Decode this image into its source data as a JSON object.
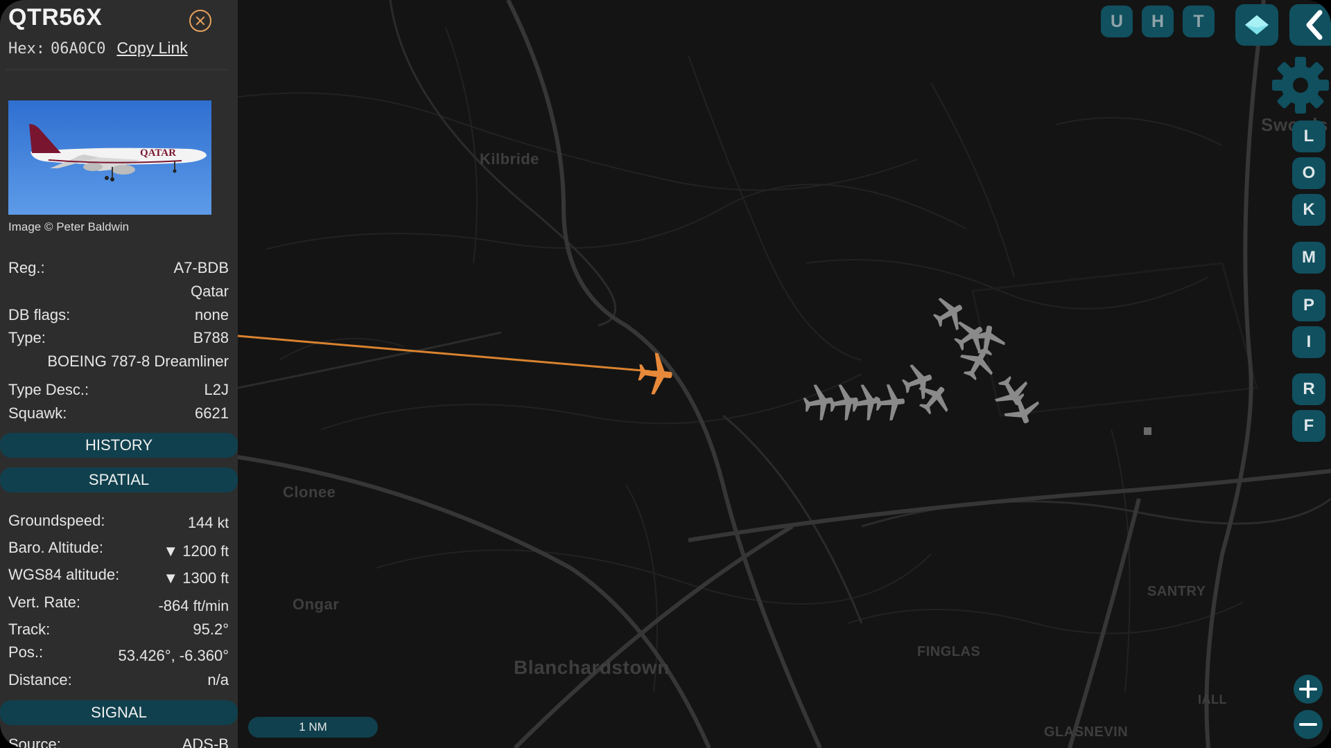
{
  "aircraft": {
    "callsign": "QTR56X",
    "hex_label": "Hex:",
    "hex": "06A0C0",
    "copy_link": "Copy Link",
    "photo_credit": "Image © Peter Baldwin",
    "photo_livery_text": "QATAR"
  },
  "details": {
    "reg_label": "Reg.:",
    "reg": "A7-BDB",
    "operator": "Qatar",
    "db_flags_label": "DB flags:",
    "db_flags": "none",
    "type_label": "Type:",
    "type": "B788",
    "type_name": "BOEING 787-8 Dreamliner",
    "type_desc_label": "Type Desc.:",
    "type_desc": "L2J",
    "squawk_label": "Squawk:",
    "squawk": "6621"
  },
  "sections": {
    "history": "HISTORY",
    "spatial": "SPATIAL",
    "signal": "SIGNAL"
  },
  "spatial": {
    "groundspeed_label": "Groundspeed:",
    "groundspeed": "144",
    "groundspeed_unit": "kt",
    "baro_label": "Baro. Altitude:",
    "baro": "▼ 1200",
    "baro_unit": "ft",
    "wgs_label": "WGS84 altitude:",
    "wgs": "▼ 1300",
    "wgs_unit": "ft",
    "vrate_label": "Vert. Rate:",
    "vrate": "-864",
    "vrate_unit": "ft/min",
    "track_label": "Track:",
    "track": "95.2°",
    "pos_label": "Pos.:",
    "pos": "53.426°, -6.360°",
    "distance_label": "Distance:",
    "distance": "n/a"
  },
  "signal": {
    "source_label": "Source:",
    "source": "ADS-B"
  },
  "map": {
    "places": [
      "Kilbride",
      "Clonee",
      "Ongar",
      "Blanchardstown",
      "SANTRY",
      "FINGLAS",
      "GLASNEVIN",
      "IALL",
      "Swords"
    ],
    "scale": "1 NM",
    "selected_aircraft_color": "#e8893a",
    "other_aircraft_color": "#8a8a8a",
    "trail_color": "#d9832f"
  },
  "toolbar": {
    "top": [
      "U",
      "H",
      "T"
    ],
    "side": [
      "L",
      "O",
      "K",
      "M",
      "P",
      "I",
      "R",
      "F"
    ]
  },
  "colors": {
    "panel": "#2d2d2d",
    "accent_button": "#10505f",
    "section_bar": "#10404d"
  }
}
